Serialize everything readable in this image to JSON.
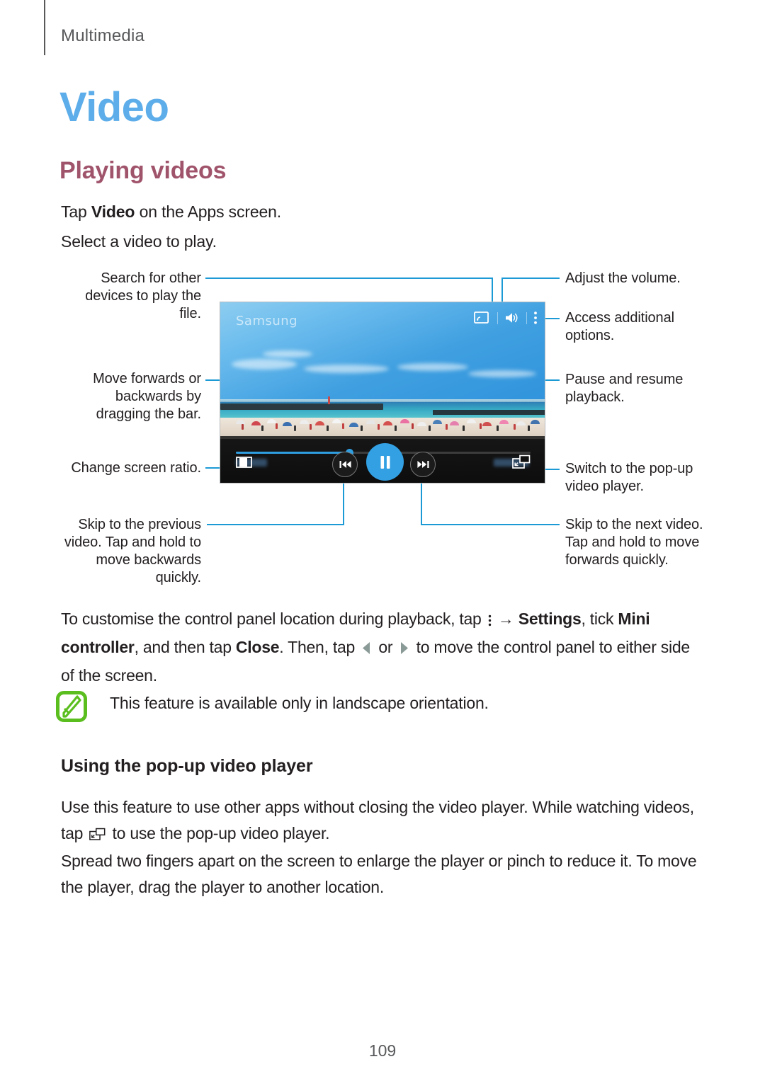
{
  "header": {
    "breadcrumb": "Multimedia"
  },
  "titles": {
    "chapter": "Video",
    "section": "Playing videos",
    "subsection": "Using the pop-up video player"
  },
  "intro": {
    "line1_prefix": "Tap ",
    "line1_bold": "Video",
    "line1_suffix": " on the Apps screen.",
    "line2": "Select a video to play."
  },
  "callouts": {
    "search_devices": "Search for other devices to play the file.",
    "move_forwards": "Move forwards or backwards by dragging the bar.",
    "change_ratio": "Change screen ratio.",
    "skip_previous": "Skip to the previous video. Tap and hold to move backwards quickly.",
    "adjust_volume": "Adjust the volume.",
    "access_options": "Access additional options.",
    "pause_resume": "Pause and resume playback.",
    "switch_popup": "Switch to the pop-up video player.",
    "skip_next": "Skip to the next video. Tap and hold to move forwards quickly."
  },
  "device": {
    "watermark": "Samsung",
    "icons": {
      "screen_mirroring": "screen-mirroring-icon",
      "volume": "volume-icon",
      "more_options": "more-options-icon",
      "screen_ratio": "screen-ratio-icon",
      "previous": "skip-previous-icon",
      "play_pause": "pause-icon",
      "next": "skip-next-icon",
      "popup_player": "popup-player-icon"
    },
    "progress_percent": 37
  },
  "paragraphs": {
    "customise": {
      "t1": "To customise the control panel location during playback, tap ",
      "t2": " → ",
      "b1": "Settings",
      "t3": ", tick ",
      "b2": "Mini controller",
      "t4": ", and then tap ",
      "b3": "Close",
      "t5": ". Then, tap ",
      "t6": " or ",
      "t7": " to move the control panel to either side of the screen."
    },
    "note": "This feature is available only in landscape orientation.",
    "popup_1a": "Use this feature to use other apps without closing the video player. While watching videos, tap ",
    "popup_1b": " to use the pop-up video player.",
    "popup_2": "Spread two fingers apart on the screen to enlarge the player or pinch to reduce it. To move the player, drag the player to another location."
  },
  "footer": {
    "page_number": "109"
  },
  "colors": {
    "chapter_blue": "#5cade9",
    "section_mauve": "#a0546c",
    "leader_blue": "#1b9ad6",
    "accent_play": "#32a0e3",
    "note_green": "#5bbe1f"
  }
}
